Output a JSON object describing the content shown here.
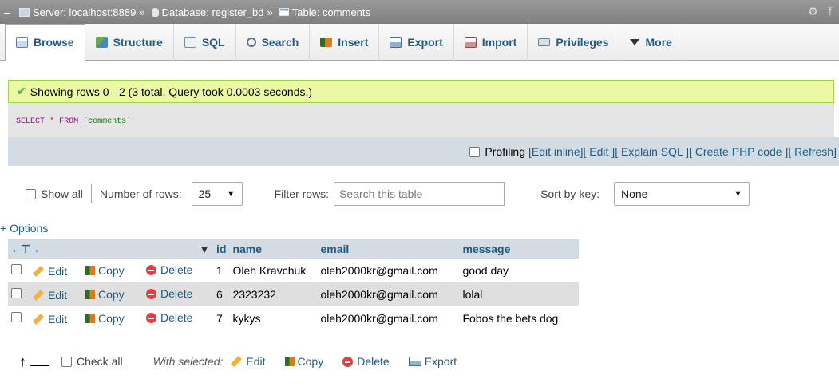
{
  "breadcrumb": {
    "server": "Server: localhost:8889",
    "database": "Database: register_bd",
    "table": "Table: comments",
    "separator": "»"
  },
  "tabs": [
    {
      "label": "Browse",
      "icon": "browse-icon",
      "active": true
    },
    {
      "label": "Structure",
      "icon": "structure-icon"
    },
    {
      "label": "SQL",
      "icon": "sql-icon"
    },
    {
      "label": "Search",
      "icon": "search-icon"
    },
    {
      "label": "Insert",
      "icon": "insert-icon"
    },
    {
      "label": "Export",
      "icon": "export-icon"
    },
    {
      "label": "Import",
      "icon": "import-icon"
    },
    {
      "label": "Privileges",
      "icon": "privileges-icon"
    },
    {
      "label": "More",
      "icon": "caret-down-icon"
    }
  ],
  "message": {
    "text": "Showing rows 0 - 2 (3 total, Query took 0.0003 seconds.)"
  },
  "query": {
    "select": "SELECT",
    "star": "*",
    "from": "FROM",
    "table": "`comments`"
  },
  "profiling": {
    "label": "Profiling",
    "links": [
      "[Edit inline]",
      "[ Edit ]",
      "[ Explain SQL ]",
      "[ Create PHP code ]",
      "[ Refresh]"
    ]
  },
  "nav": {
    "show_all": "Show all",
    "number_of_rows_label": "Number of rows:",
    "number_of_rows_value": "25",
    "filter_label": "Filter rows:",
    "filter_placeholder": "Search this table",
    "sort_label": "Sort by key:",
    "sort_value": "None"
  },
  "options_link": "+ Options",
  "table": {
    "columns": [
      "id",
      "name",
      "email",
      "message"
    ],
    "actions": {
      "edit": "Edit",
      "copy": "Copy",
      "delete": "Delete"
    },
    "rows": [
      {
        "id": "1",
        "name": "Oleh Kravchuk",
        "email": "oleh2000kr@gmail.com",
        "message": "good day"
      },
      {
        "id": "6",
        "name": "2323232",
        "email": "oleh2000kr@gmail.com",
        "message": "lolal"
      },
      {
        "id": "7",
        "name": "kykys",
        "email": "oleh2000kr@gmail.com",
        "message": "Fobos the bets dog"
      }
    ]
  },
  "bottom": {
    "check_all": "Check all",
    "with_selected": "With selected:",
    "edit": "Edit",
    "copy": "Copy",
    "delete": "Delete",
    "export": "Export"
  },
  "colors": {
    "accent": "#235a81",
    "success_bg": "#ebf8a4",
    "header_bg": "#d3dce3"
  }
}
